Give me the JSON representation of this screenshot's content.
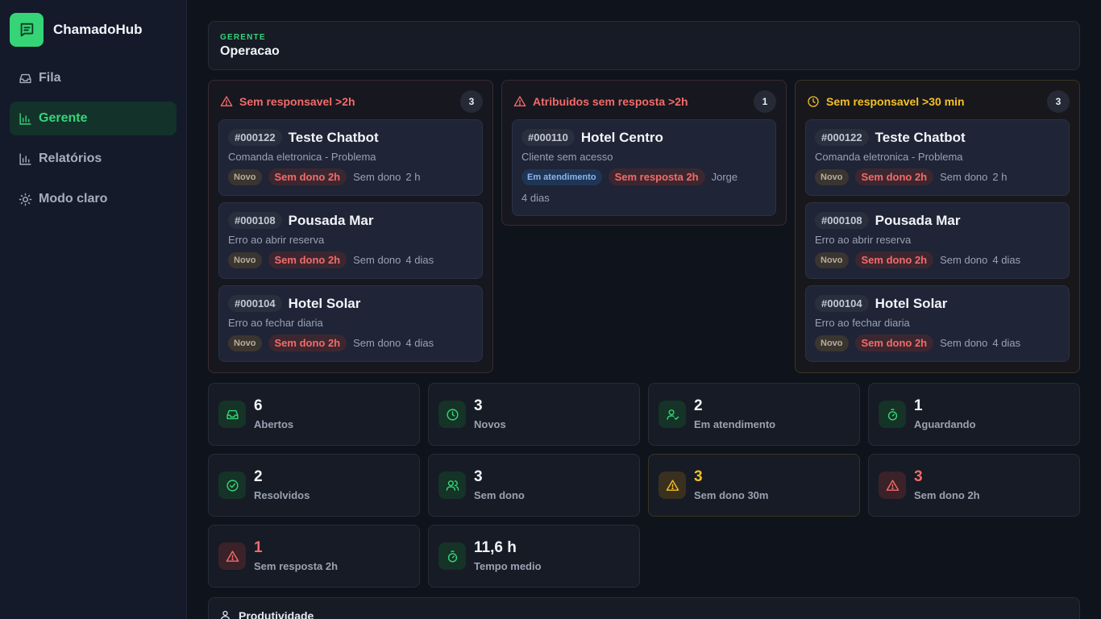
{
  "app": {
    "name": "ChamadoHub",
    "logo_icon": "chat-list-icon",
    "accent": "#34d477"
  },
  "sidebar": {
    "items": [
      {
        "label": "Fila",
        "icon": "inbox-icon",
        "active": false
      },
      {
        "label": "Gerente",
        "icon": "bar-chart-icon",
        "active": true
      },
      {
        "label": "Relatórios",
        "icon": "bar-chart-icon",
        "active": false
      },
      {
        "label": "Modo claro",
        "icon": "sun-icon",
        "active": false
      }
    ]
  },
  "header": {
    "kicker": "GERENTE",
    "title": "Operacao"
  },
  "columns": [
    {
      "title": "Sem responsavel >2h",
      "count": "3",
      "icon": "alert-triangle-icon",
      "tickets": [
        {
          "id": "#000122",
          "name": "Teste Chatbot",
          "desc": "Comanda eletronica - Problema",
          "status": "Novo",
          "alert": "Sem dono 2h",
          "m1": "Sem dono",
          "m2": "2 h"
        },
        {
          "id": "#000108",
          "name": "Pousada Mar",
          "desc": "Erro ao abrir reserva",
          "status": "Novo",
          "alert": "Sem dono 2h",
          "m1": "Sem dono",
          "m2": "4 dias"
        },
        {
          "id": "#000104",
          "name": "Hotel Solar",
          "desc": "Erro ao fechar diaria",
          "status": "Novo",
          "alert": "Sem dono 2h",
          "m1": "Sem dono",
          "m2": "4 dias"
        }
      ]
    },
    {
      "title": "Atribuidos sem resposta >2h",
      "count": "1",
      "icon": "alert-triangle-icon",
      "tickets": [
        {
          "id": "#000110",
          "name": "Hotel Centro",
          "desc": "Cliente sem acesso",
          "status": "Em atendimento",
          "alert": "Sem resposta 2h",
          "m1": "Jorge",
          "m2": "4 dias"
        }
      ]
    },
    {
      "title": "Sem responsavel >30 min",
      "count": "3",
      "icon": "clock-icon",
      "tickets": [
        {
          "id": "#000122",
          "name": "Teste Chatbot",
          "desc": "Comanda eletronica - Problema",
          "status": "Novo",
          "alert": "Sem dono 2h",
          "m1": "Sem dono",
          "m2": "2 h"
        },
        {
          "id": "#000108",
          "name": "Pousada Mar",
          "desc": "Erro ao abrir reserva",
          "status": "Novo",
          "alert": "Sem dono 2h",
          "m1": "Sem dono",
          "m2": "4 dias"
        },
        {
          "id": "#000104",
          "name": "Hotel Solar",
          "desc": "Erro ao fechar diaria",
          "status": "Novo",
          "alert": "Sem dono 2h",
          "m1": "Sem dono",
          "m2": "4 dias"
        }
      ]
    }
  ],
  "stats": [
    {
      "value": "6",
      "label": "Abertos",
      "icon": "inbox-icon"
    },
    {
      "value": "3",
      "label": "Novos",
      "icon": "clock-icon"
    },
    {
      "value": "2",
      "label": "Em atendimento",
      "icon": "user-check-icon"
    },
    {
      "value": "1",
      "label": "Aguardando",
      "icon": "timer-icon"
    },
    {
      "value": "2",
      "label": "Resolvidos",
      "icon": "check-circle-icon"
    },
    {
      "value": "3",
      "label": "Sem dono",
      "icon": "users-icon"
    },
    {
      "value": "3",
      "label": "Sem dono 30m",
      "icon": "alert-triangle-icon"
    },
    {
      "value": "3",
      "label": "Sem dono 2h",
      "icon": "alert-triangle-icon"
    },
    {
      "value": "1",
      "label": "Sem resposta 2h",
      "icon": "alert-triangle-icon"
    },
    {
      "value": "11,6 h",
      "label": "Tempo medio",
      "icon": "timer-icon"
    }
  ],
  "productivity": {
    "title": "Produtividade",
    "icon": "user-icon"
  },
  "colors": {
    "green": "#36d57a",
    "red": "#f26b6b",
    "yellow": "#f4c025"
  }
}
